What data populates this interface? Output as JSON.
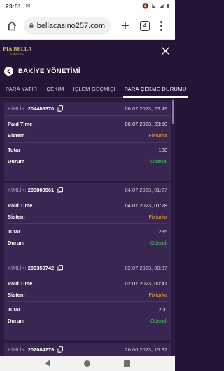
{
  "status_bar": {
    "time": "23:51",
    "battery": ""
  },
  "browser": {
    "url": "bellacasino257.com",
    "tab_count": "4"
  },
  "site": {
    "logo_main": "PIA BELLA",
    "logo_sub": "CASINO"
  },
  "page": {
    "title": "BAKİYE YÖNETİMİ"
  },
  "tabs": [
    {
      "label": "PARA YATIR"
    },
    {
      "label": "ÇEKİM"
    },
    {
      "label": "İŞLEM GEÇMİŞİ"
    },
    {
      "label": "PARA ÇEKME DURUMU"
    }
  ],
  "card_labels": {
    "id_label": "KİMLİK:",
    "paid_time": "Paid Time",
    "system": "Sistem",
    "amount": "Tutar",
    "status": "Durum"
  },
  "transactions": [
    {
      "id": "204486370",
      "created": "06.07.2023, 23:49",
      "paid_time": "06.07.2023, 23:50",
      "system": "Fixturka",
      "amount": "100",
      "status": "Ödendi"
    },
    {
      "id": "203803961",
      "created": "04.07.2023, 01:27",
      "paid_time": "04.07.2023, 01:28",
      "system": "Fixturka",
      "amount": "285",
      "status": "Ödendi"
    },
    {
      "id": "203350742",
      "created": "02.07.2023, 00:37",
      "paid_time": "02.07.2023, 00:41",
      "system": "Fixturka",
      "amount": "200",
      "status": "Ödendi"
    },
    {
      "id": "202084279",
      "created": "26.06.2023, 15:32"
    }
  ],
  "colors": {
    "background": "#241536",
    "card": "#3a2652",
    "system": "#e2a332",
    "paid": "#3fc25e"
  }
}
